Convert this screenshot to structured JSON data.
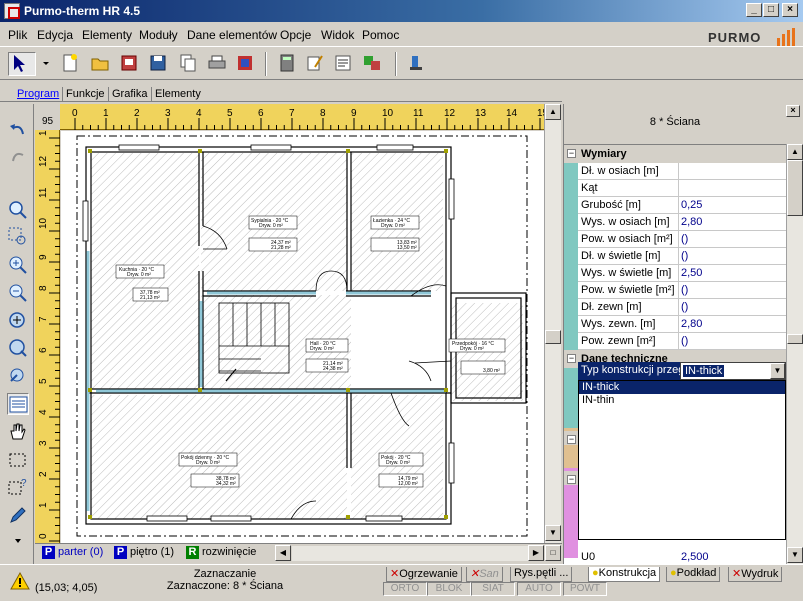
{
  "window": {
    "title": "Purmo-therm HR 4.5",
    "minimize": "_",
    "maximize": "□",
    "close": "×"
  },
  "menu": [
    "Plik",
    "Edycja",
    "Elementy",
    "Moduły",
    "Dane elementów",
    "Opcje",
    "Widok",
    "Pomoc"
  ],
  "logo": {
    "text": "PURMO",
    "color": "#e8731b"
  },
  "tabs": [
    "Program",
    "Funkcje",
    "Grafika",
    "Elementy"
  ],
  "ruler": {
    "corner": "95",
    "h_ticks": [
      "0",
      "1",
      "2",
      "3",
      "4",
      "5",
      "6",
      "7",
      "8",
      "9",
      "10",
      "11",
      "12",
      "13",
      "14",
      "15"
    ],
    "v_ticks": [
      "13",
      "12",
      "11",
      "10",
      "9",
      "8",
      "7",
      "6",
      "5",
      "4",
      "3",
      "2",
      "1",
      "0"
    ]
  },
  "rooms": [
    {
      "name": "Kuchnia · 20 °C",
      "sub": "Dryw. 0 m²",
      "a1": "37,78 m²",
      "a2": "21,13 m²"
    },
    {
      "name": "Sypialnia · 20 °C",
      "sub": "Dryw. 0 m²",
      "a1": "24,37 m²",
      "a2": "21,28 m²"
    },
    {
      "name": "Łazienka · 24 °C",
      "sub": "Dryw. 0 m²",
      "a1": "13,83 m²",
      "a2": "13,50 m²"
    },
    {
      "name": "Hall · 20 °C",
      "sub": "Dryw. 0 m²",
      "a1": "21,14 m²",
      "a2": "24,38 m²"
    },
    {
      "name": "Przedpokój · 16 °C",
      "sub": "Dryw. 0 m²",
      "a1": "",
      "a2": "3,80 m²"
    },
    {
      "name": "Pokój dzienny · 20 °C",
      "sub": "Dryw. 0 m²",
      "a1": "38,78 m²",
      "a2": "34,32 m²"
    },
    {
      "name": "Pokój · 20 °C",
      "sub": "Dryw. 0 m²",
      "a1": "14,79 m²",
      "a2": "12,00 m²"
    }
  ],
  "sheets": [
    {
      "letter": "P",
      "label": "parter (0)",
      "color": "#0000c0"
    },
    {
      "letter": "P",
      "label": "piętro (1)",
      "color": "#0000c0"
    },
    {
      "letter": "R",
      "label": "rozwinięcie",
      "color": "#008000"
    }
  ],
  "panel": {
    "title": "8 * Ściana",
    "group1": "Wymiary",
    "rows": [
      {
        "label": "Dł. w osiach [m]",
        "value": ""
      },
      {
        "label": "Kąt",
        "value": ""
      },
      {
        "label": "Grubość [m]",
        "value": "0,25"
      },
      {
        "label": "Wys. w osiach [m]",
        "value": "2,80"
      },
      {
        "label": "Pow. w osiach [m²]",
        "value": "()"
      },
      {
        "label": "Dł. w świetle [m]",
        "value": "()"
      },
      {
        "label": "Wys. w świetle [m]",
        "value": "2,50"
      },
      {
        "label": "Pow. w świetle [m²]",
        "value": "()"
      },
      {
        "label": "Dł. zewn [m]",
        "value": "()"
      },
      {
        "label": "Wys. zewn. [m]",
        "value": "2,80"
      },
      {
        "label": "Pow. zewn [m²]",
        "value": "()"
      }
    ],
    "group2": "Dane techniczne",
    "dropdown_label": "Typ konstrukcji przegrody",
    "dropdown_value": "IN-thick",
    "options": [
      "IN-thick",
      "IN-thin"
    ],
    "bottom_row": {
      "label": "U0",
      "value": "2,500"
    }
  },
  "status": {
    "coords": "(15,03; 4,05)",
    "mode": "Zaznaczanie",
    "selection": "Zaznaczone: 8 * Ściana",
    "tabs": [
      "Ogrzewanie",
      "San",
      "Rys.pętli ...",
      "Konstrukcja",
      "Podkład",
      "Wydruk"
    ],
    "flags": [
      "ORTO",
      "BLOK",
      "SIAT",
      "AUTO",
      "POWT"
    ]
  }
}
